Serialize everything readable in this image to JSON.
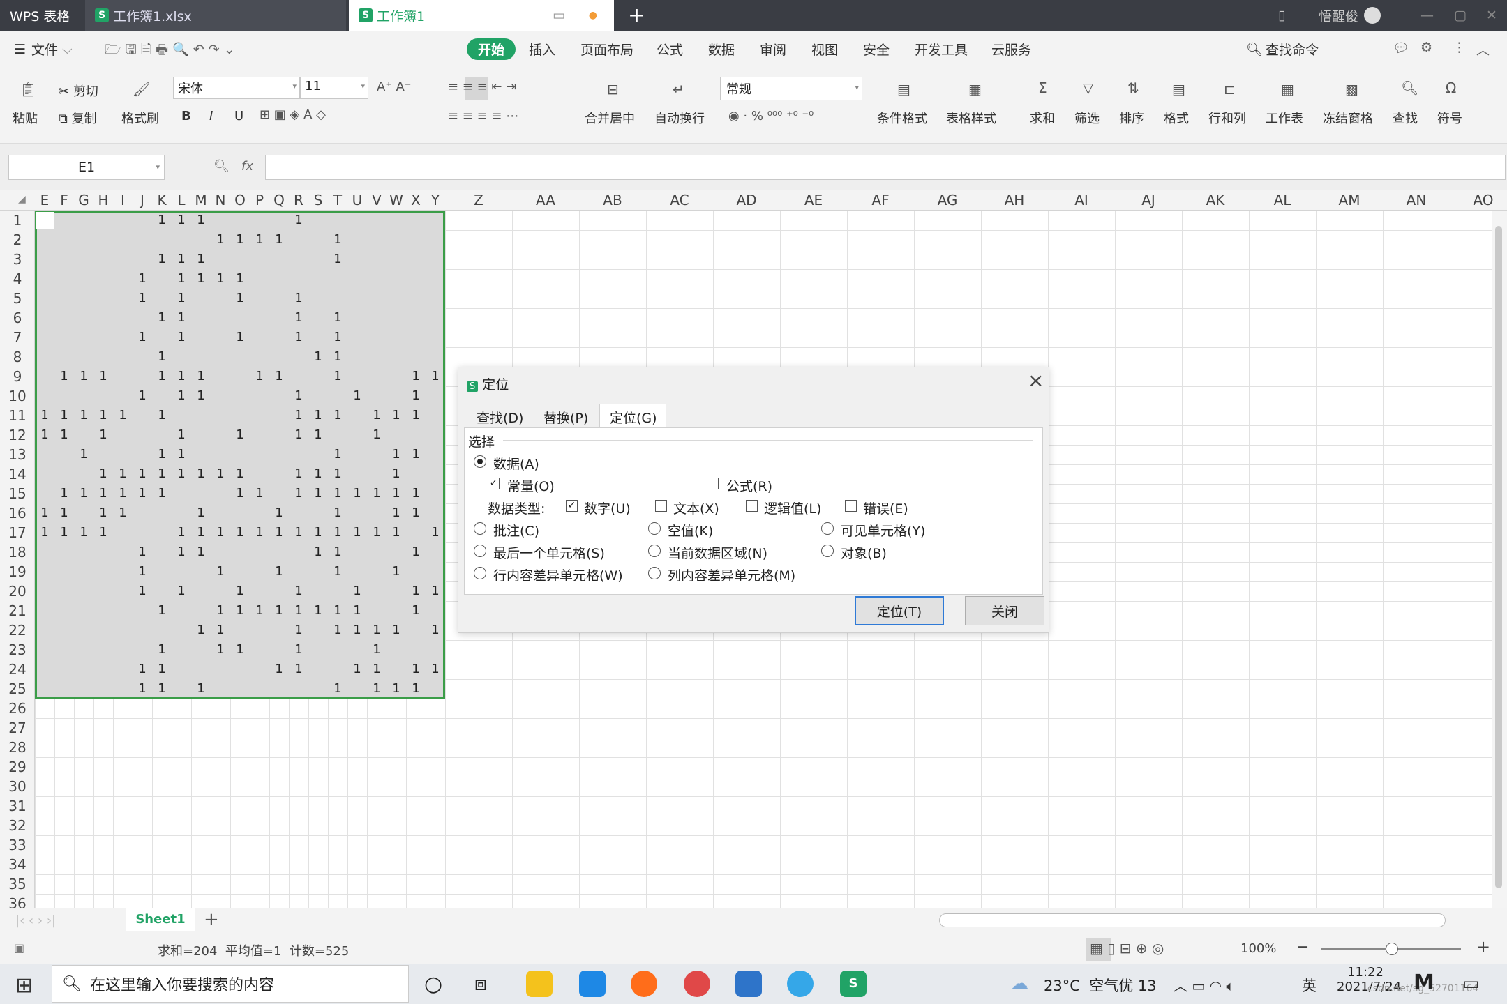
{
  "titlebar": {
    "app_tab": "WPS 表格",
    "doc_tab1": "工作簿1.xlsx",
    "doc_tab2": "工作簿1",
    "user": "悟醒俊"
  },
  "menu": {
    "file": "文件",
    "items": [
      "开始",
      "插入",
      "页面布局",
      "公式",
      "数据",
      "审阅",
      "视图",
      "安全",
      "开发工具",
      "云服务"
    ],
    "search": "查找命令"
  },
  "ribbon": {
    "paste": "粘贴",
    "cut": "剪切",
    "copy": "复制",
    "format_painter": "格式刷",
    "font_name": "宋体",
    "font_size": "11",
    "number_format": "常规",
    "merge": "合并居中",
    "wrap": "自动换行",
    "cond_format": "条件格式",
    "table_style": "表格样式",
    "sum": "求和",
    "filter": "筛选",
    "sort": "排序",
    "format": "格式",
    "rowcol": "行和列",
    "worksheet": "工作表",
    "freeze": "冻结窗格",
    "find": "查找",
    "symbol": "符号",
    "bold": "B",
    "italic": "I",
    "underline": "U",
    "percent": "%"
  },
  "formula_bar": {
    "name_box": "E1",
    "fx": "fx",
    "value": ""
  },
  "columns": {
    "narrow": [
      "E",
      "F",
      "G",
      "H",
      "I",
      "J",
      "K",
      "L",
      "M",
      "N",
      "O",
      "P",
      "Q",
      "R",
      "S",
      "T",
      "U",
      "V",
      "W",
      "X",
      "Y"
    ],
    "wide": [
      "Z",
      "AA",
      "AB",
      "AC",
      "AD",
      "AE",
      "AF",
      "AG",
      "AH",
      "AI",
      "AJ",
      "AK",
      "AL",
      "AM",
      "AN",
      "AO"
    ]
  },
  "rows": [
    "1",
    "2",
    "3",
    "4",
    "5",
    "6",
    "7",
    "8",
    "9",
    "10",
    "11",
    "12",
    "13",
    "14",
    "15",
    "16",
    "17",
    "18",
    "19",
    "20",
    "21",
    "22",
    "23",
    "24",
    "25",
    "26",
    "27",
    "28",
    "29",
    "30",
    "31",
    "32",
    "33",
    "34",
    "35",
    "36"
  ],
  "cells": [
    "......111....1.......",
    ".........1111..1.....",
    "......111......1.....",
    ".....1.1111..........",
    ".....1.1..1..1.......",
    "......11.....1.1.....",
    ".....1.1..1..1.1.....",
    "......1.......11.....",
    ".111..111..11..1...11",
    ".....1.11....1..1..1.",
    "11111.1......111.111.",
    "11.1...1..1..11..1...",
    "..1...11.......1..11.",
    "...11111111..111..1..",
    ".111111...11.1111111.",
    "11.11...1...1..1..11.",
    "1111...111111111111.1",
    ".....1.11.....11...1.",
    ".....1...1..1..1..1..",
    ".....1.1..1..1..1..11",
    "......1..11111111..1.",
    "........11...1.1111.1",
    "......1..11..1...1...",
    ".....11.....11..11.11",
    ".....11.1......1.111."
  ],
  "dialog": {
    "title": "定位",
    "close": "×",
    "tabs": [
      "查找(D)",
      "替换(P)",
      "定位(G)"
    ],
    "group": "选择",
    "data": "数据(A)",
    "constants": "常量(O)",
    "formulas": "公式(R)",
    "data_type": "数据类型:",
    "numbers": "数字(U)",
    "text": "文本(X)",
    "logical": "逻辑值(L)",
    "errors": "错误(E)",
    "comments": "批注(C)",
    "blanks": "空值(K)",
    "visible": "可见单元格(Y)",
    "last_cell": "最后一个单元格(S)",
    "current_region": "当前数据区域(N)",
    "objects": "对象(B)",
    "row_diff": "行内容差异单元格(W)",
    "col_diff": "列内容差异单元格(M)",
    "ok": "定位(T)",
    "cancel": "关闭"
  },
  "sheet": {
    "tab": "Sheet1",
    "add": "+"
  },
  "status": {
    "summary": "求和=204  平均值=1  计数=525",
    "zoom": "100%"
  },
  "taskbar": {
    "search": "在这里输入你要搜索的内容",
    "weather": "23°C  空气优 13",
    "ime": "英",
    "time": "11:22",
    "date": "2021/7/24",
    "watermark": "csdn.net/sg_52701164"
  }
}
